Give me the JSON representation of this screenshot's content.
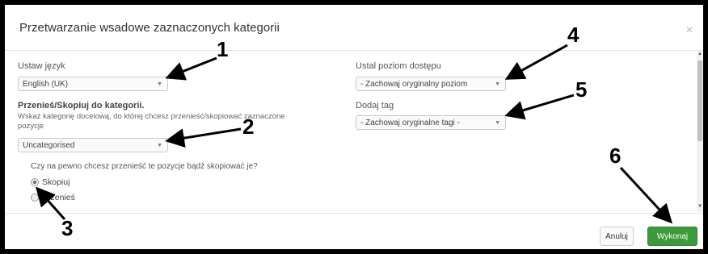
{
  "dialog": {
    "title": "Przetwarzanie wsadowe zaznaczonych kategorii",
    "close_icon": "close-icon"
  },
  "fields": {
    "language": {
      "label": "Ustaw język",
      "value": "English (UK)"
    },
    "move_copy": {
      "label": "Przenieś/Skopiuj do kategorii.",
      "help_line1": "Wskaż kategorię docelową, do której chcesz przenieść/skopiować zaznaczone",
      "help_line2": "pozycje",
      "value": "Uncategorised"
    },
    "question": "Czy na pewno chcesz przenieść te pozycje bądź skopiować je?",
    "radios": [
      {
        "label": "Skopiuj",
        "checked": true
      },
      {
        "label": "Przenieś",
        "checked": false
      }
    ],
    "access": {
      "label": "Ustal poziom dostępu",
      "value": "- Zachowaj oryginalny poziom"
    },
    "tag": {
      "label": "Dodaj tag",
      "value": "- Zachowaj oryginalne tagi -"
    }
  },
  "footer": {
    "cancel_label": "Anuluj",
    "run_label": "Wykonaj"
  },
  "annotations": [
    "1",
    "2",
    "3",
    "4",
    "5",
    "6"
  ],
  "colors": {
    "run_button": "#3c9a3c",
    "background": "#000000"
  }
}
